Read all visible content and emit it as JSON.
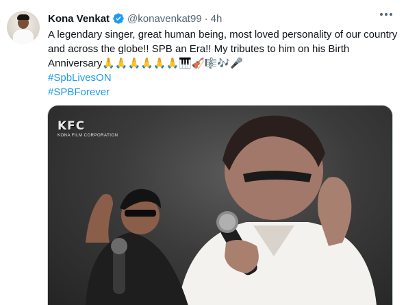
{
  "tweet": {
    "author_name": "Kona Venkat",
    "handle": "@konavenkat99",
    "separator": "·",
    "time": "4h",
    "text": "A legendary singer, great human being, most loved personality of our country and across the globe!! SPB an Era!! My tributes to him on his Birth Anniversary",
    "emojis": "🙏🙏🙏🙏🙏🙏🎹🎻🎼🎶🎤",
    "hashtags": [
      "#SpbLivesON",
      "#SPBForever"
    ]
  },
  "media": {
    "logo_text": "KFC",
    "logo_subtext": "KONA FILM CORPORATION"
  },
  "colors": {
    "link": "#1d9bf0",
    "verified": "#1d9bf0",
    "secondary_text": "#536471"
  },
  "icons": {
    "verified": "verified-badge-icon",
    "more": "more-options-icon"
  }
}
